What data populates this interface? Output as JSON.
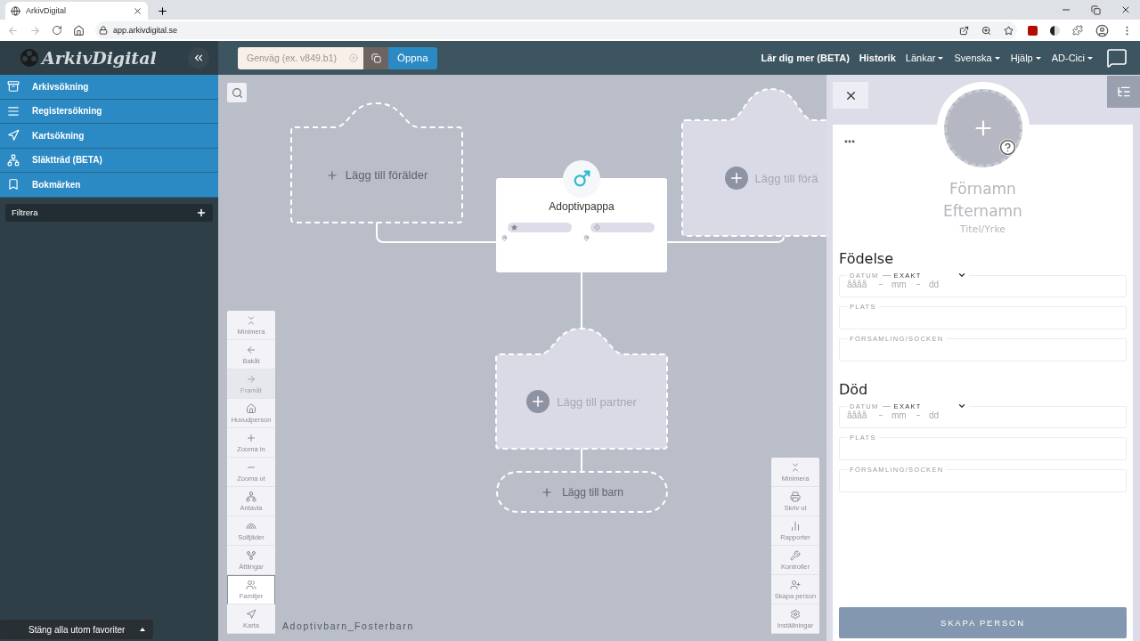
{
  "browser": {
    "tab_title": "ArkivDigital",
    "url": "app.arkivdigital.se"
  },
  "header": {
    "logo": "ArkivDigital",
    "shortcut": {
      "placeholder": "Genväg (ex. v849.b1)"
    },
    "open_button": "Öppna",
    "nav": [
      {
        "label": "Lär dig mer (BETA)",
        "dropdown": false
      },
      {
        "label": "Historik",
        "dropdown": false
      },
      {
        "label": "Länkar",
        "dropdown": true
      },
      {
        "label": "Svenska",
        "dropdown": true
      },
      {
        "label": "Hjälp",
        "dropdown": true
      },
      {
        "label": "AD-Cici",
        "dropdown": true
      }
    ]
  },
  "sidebar": {
    "items": [
      {
        "label": "Arkivsökning"
      },
      {
        "label": "Registersökning"
      },
      {
        "label": "Kartsökning"
      },
      {
        "label": "Släktträd (BETA)"
      },
      {
        "label": "Bokmärken"
      }
    ],
    "filter": "Filtrera",
    "bottom_chip": "Stäng alla utom favoriter"
  },
  "canvas": {
    "add_parent_left": "Lägg till förälder",
    "add_parent_right": "Lägg till förä",
    "person": {
      "role": "Adoptivpappa"
    },
    "add_partner": "Lägg till partner",
    "add_child": "Lägg till barn",
    "view_name": "Adoptivbarn_Fosterbarn",
    "left_tools": [
      {
        "label": "Minimera",
        "selected": false,
        "disabled": false
      },
      {
        "label": "Bakåt",
        "selected": false,
        "disabled": false
      },
      {
        "label": "Framåt",
        "selected": false,
        "disabled": true
      },
      {
        "label": "Huvudperson",
        "selected": false,
        "disabled": false
      },
      {
        "label": "Zooma in",
        "selected": false,
        "disabled": false
      },
      {
        "label": "Zooma ut",
        "selected": false,
        "disabled": false
      },
      {
        "label": "Antavla",
        "selected": false,
        "disabled": false
      },
      {
        "label": "Solfjäder",
        "selected": false,
        "disabled": false
      },
      {
        "label": "Ättlingar",
        "selected": false,
        "disabled": false
      },
      {
        "label": "Familjer",
        "selected": true,
        "disabled": false
      },
      {
        "label": "Karta",
        "selected": false,
        "disabled": false
      }
    ],
    "right_tools": [
      {
        "label": "Minimera"
      },
      {
        "label": "Skriv ut"
      },
      {
        "label": "Rapporter"
      },
      {
        "label": "Kontroller"
      },
      {
        "label": "Skapa person"
      },
      {
        "label": "Inställningar"
      }
    ]
  },
  "panel": {
    "first_name": {
      "placeholder": "Förnamn"
    },
    "last_name": {
      "placeholder": "Efternamn"
    },
    "title": {
      "placeholder": "Titel/Yrke"
    },
    "sections": [
      {
        "heading": "Födelse",
        "fields": [
          {
            "kind": "date",
            "label": "DATUM",
            "mode": "EXAKT",
            "placeholders": [
              "åååå",
              "mm",
              "dd"
            ]
          },
          {
            "kind": "text",
            "label": "PLATS"
          },
          {
            "kind": "text",
            "label": "FÖRSAMLING/SOCKEN"
          }
        ]
      },
      {
        "heading": "Död",
        "fields": [
          {
            "kind": "date",
            "label": "DATUM",
            "mode": "EXAKT",
            "placeholders": [
              "åååå",
              "mm",
              "dd"
            ]
          },
          {
            "kind": "text",
            "label": "PLATS"
          },
          {
            "kind": "text",
            "label": "FÖRSAMLING/SOCKEN"
          }
        ]
      }
    ],
    "submit": {
      "label": "SKAPA PERSON",
      "disabled": true
    }
  }
}
